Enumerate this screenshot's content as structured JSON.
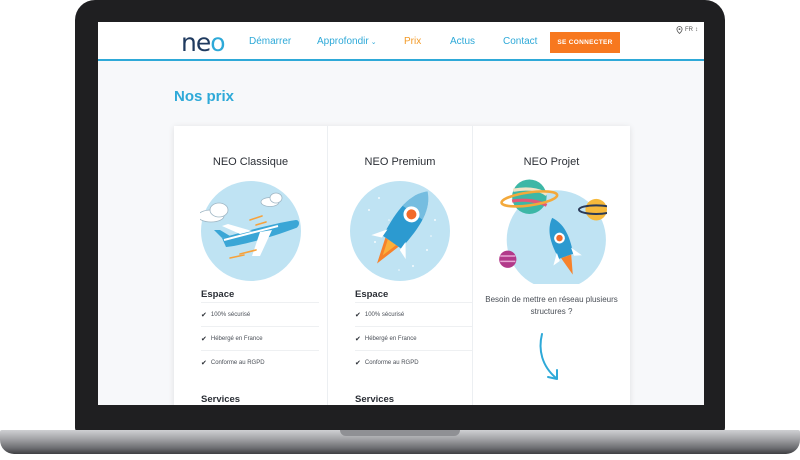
{
  "header": {
    "logo": {
      "part1": "ne",
      "part2": "o"
    },
    "nav": [
      {
        "label": "Démarrer",
        "active": false
      },
      {
        "label": "Approfondir",
        "active": false,
        "has_dropdown": true
      },
      {
        "label": "Prix",
        "active": true
      },
      {
        "label": "Actus",
        "active": false
      },
      {
        "label": "Contact",
        "active": false
      }
    ],
    "login_label": "SE CONNECTER",
    "language": "FR"
  },
  "main": {
    "title": "Nos prix",
    "plans": [
      {
        "name": "NEO Classique",
        "illustration": "airplane-clouds",
        "section_title": "Espace",
        "features": [
          "100% sécurisé",
          "Hébergé en France",
          "Conforme au RGPD"
        ],
        "next_section": "Services"
      },
      {
        "name": "NEO Premium",
        "illustration": "rocket",
        "section_title": "Espace",
        "features": [
          "100% sécurisé",
          "Hébergé en France",
          "Conforme au RGPD"
        ],
        "next_section": "Services"
      },
      {
        "name": "NEO Projet",
        "illustration": "rocket-planets",
        "description": "Besoin de mettre en réseau plusieurs structures ?",
        "icon": "curved-arrow-down-icon"
      }
    ]
  },
  "colors": {
    "accent": "#2ea9d8",
    "active_nav": "#f39a27",
    "button": "#f7781f",
    "text": "#2b2f36"
  }
}
